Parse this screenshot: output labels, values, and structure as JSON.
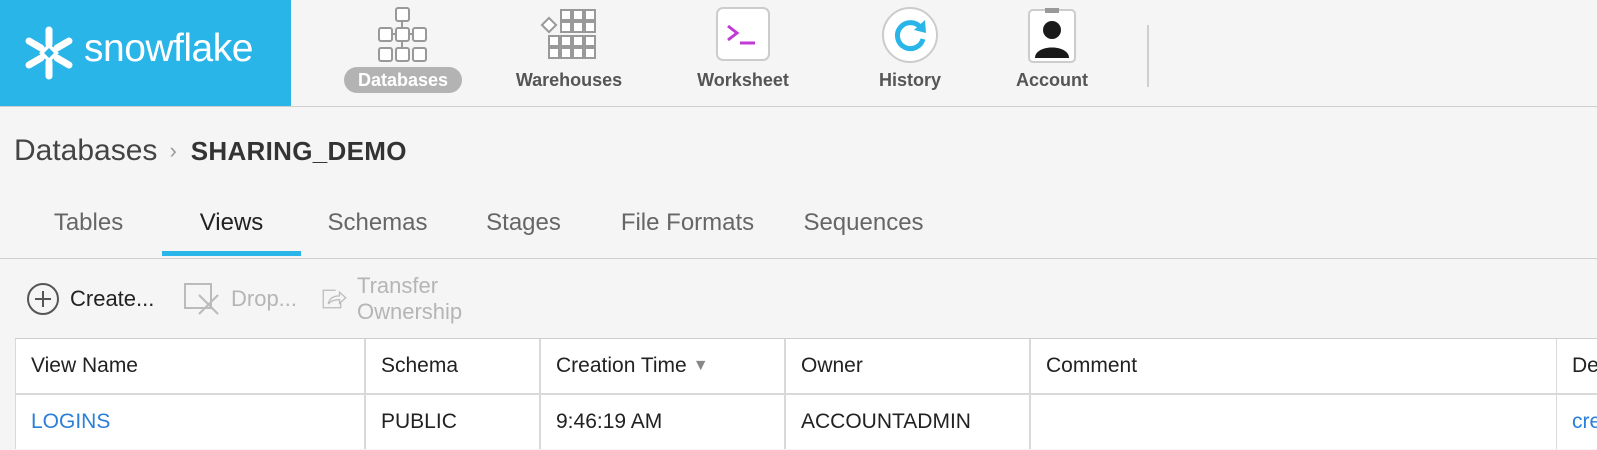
{
  "app": {
    "brand": "snowflake",
    "brand_color": "#29b5e8"
  },
  "nav": {
    "items": [
      {
        "label": "Databases",
        "icon": "databases-icon",
        "active": true
      },
      {
        "label": "Warehouses",
        "icon": "warehouses-icon"
      },
      {
        "label": "Worksheet",
        "icon": "worksheet-icon"
      },
      {
        "label": "History",
        "icon": "history-icon"
      },
      {
        "label": "Account",
        "icon": "account-icon"
      }
    ]
  },
  "breadcrumb": {
    "root": "Databases",
    "current": "SHARING_DEMO"
  },
  "tabs": [
    "Tables",
    "Views",
    "Schemas",
    "Stages",
    "File Formats",
    "Sequences"
  ],
  "active_tab": "Views",
  "toolbar": {
    "create": "Create...",
    "drop": "Drop...",
    "transfer": "Transfer Ownership"
  },
  "table": {
    "columns": [
      "View Name",
      "Schema",
      "Creation Time",
      "Owner",
      "Comment",
      "De"
    ],
    "sorted_column": "Creation Time",
    "rows": [
      {
        "view_name": "LOGINS",
        "schema": "PUBLIC",
        "creation_time": "9:46:19 AM",
        "owner": "ACCOUNTADMIN",
        "comment": "",
        "definition": "cre"
      }
    ]
  }
}
